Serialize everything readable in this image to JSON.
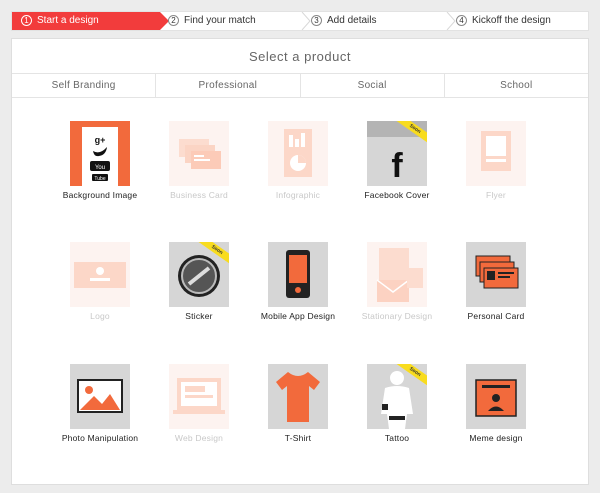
{
  "stepper": {
    "steps": [
      {
        "num": "1",
        "label": "Start a design"
      },
      {
        "num": "2",
        "label": "Find your match"
      },
      {
        "num": "3",
        "label": "Add details"
      },
      {
        "num": "4",
        "label": "Kickoff the design"
      }
    ]
  },
  "panel": {
    "title": "Select a product",
    "tabs": [
      "Self Branding",
      "Professional",
      "Social",
      "School"
    ]
  },
  "products": [
    {
      "label": "Background Image",
      "icon": "social-icons"
    },
    {
      "label": "Business Card",
      "icon": "business-card-icon"
    },
    {
      "label": "Infographic",
      "icon": "infographic-icon"
    },
    {
      "label": "Facebook Cover",
      "icon": "facebook-icon",
      "badge": "Soon"
    },
    {
      "label": "Flyer",
      "icon": "flyer-icon"
    },
    {
      "label": "Logo",
      "icon": "logo-icon"
    },
    {
      "label": "Sticker",
      "icon": "sticker-icon",
      "badge": "Soon"
    },
    {
      "label": "Mobile App Design",
      "icon": "mobile-app-icon"
    },
    {
      "label": "Stationary Design",
      "icon": "stationary-icon"
    },
    {
      "label": "Personal Card",
      "icon": "personal-card-icon"
    },
    {
      "label": "Photo Manipulation",
      "icon": "photo-icon"
    },
    {
      "label": "Web Design",
      "icon": "web-design-icon"
    },
    {
      "label": "T-Shirt",
      "icon": "tshirt-icon"
    },
    {
      "label": "Tattoo",
      "icon": "tattoo-icon",
      "badge": "Soon"
    },
    {
      "label": "Meme design",
      "icon": "meme-icon"
    }
  ],
  "colors": {
    "accent": "#f23c3c",
    "orange": "#f26a3c",
    "soon_badge": "#f8dc1e",
    "faded": "#fdd9cc"
  }
}
